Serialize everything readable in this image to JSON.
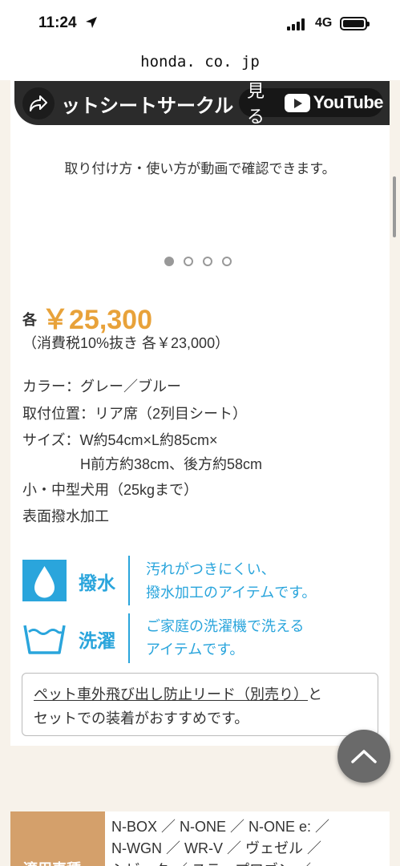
{
  "status_bar": {
    "time": "11:24",
    "network": "4G"
  },
  "browser": {
    "url": "honda. co. jp"
  },
  "video": {
    "title": "ットシートサークル",
    "watch_label": "見る",
    "youtube_label": "YouTube",
    "caption": "取り付け方・使い方が動画で確認できます。"
  },
  "carousel": {
    "total": 4,
    "active": 1
  },
  "product": {
    "price_prefix": "各",
    "price": "￥25,300",
    "tax_note": "（消費税10%抜き 各￥23,000）",
    "specs": [
      "カラー：グレー／ブルー",
      "取付位置：リア席（2列目シート）",
      "サイズ：W約54cm×L約85cm×",
      "　　　　H前方約38cm、後方約58cm",
      "小・中型犬用（25kgまで）",
      "表面撥水加工"
    ]
  },
  "features": [
    {
      "label": "撥水",
      "icon": "water-drop-icon",
      "lines": [
        "汚れがつきにくい、",
        "撥水加工のアイテムです。"
      ]
    },
    {
      "label": "洗濯",
      "icon": "washing-tub-icon",
      "lines": [
        "ご家庭の洗濯機で洗える",
        "アイテムです。"
      ]
    }
  ],
  "note": {
    "link_text": "ペット車外飛び出し防止リード（別売り）",
    "line1_suffix": "と",
    "line2": "セットでの装着がおすすめです。"
  },
  "compat": {
    "header": "適用車種",
    "lines": [
      "N-BOX ／ N-ONE ／ N-ONE e: ／",
      "N-WGN ／ WR-V ／ ヴェゼル ／",
      "シビック ／ ステップワゴン ／"
    ]
  },
  "colors": {
    "accent_price": "#e8a23a",
    "feature_blue": "#2aa5dc",
    "compat_header": "#d4a06b"
  }
}
